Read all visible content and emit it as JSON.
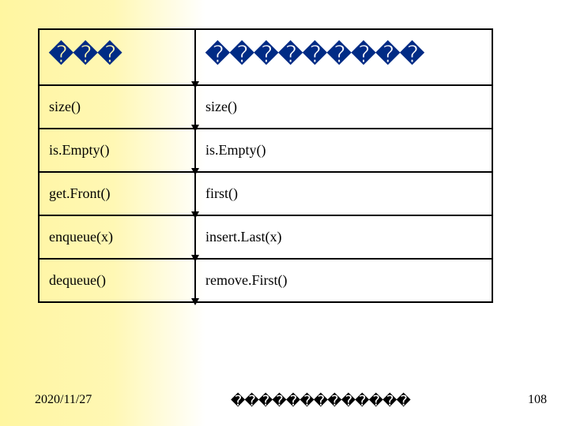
{
  "table": {
    "header": {
      "col1": "���",
      "col2": "���������"
    },
    "rows": [
      {
        "col1": "size()",
        "col2": "size()"
      },
      {
        "col1": "is.Empty()",
        "col2": "is.Empty()"
      },
      {
        "col1": "get.Front()",
        "col2": "first()"
      },
      {
        "col1": "enqueue(x)",
        "col2": "insert.Last(x)"
      },
      {
        "col1": "dequeue()",
        "col2": "remove.First()"
      }
    ]
  },
  "footer": {
    "date": "2020/11/27",
    "center": "�������������",
    "page": "108"
  }
}
